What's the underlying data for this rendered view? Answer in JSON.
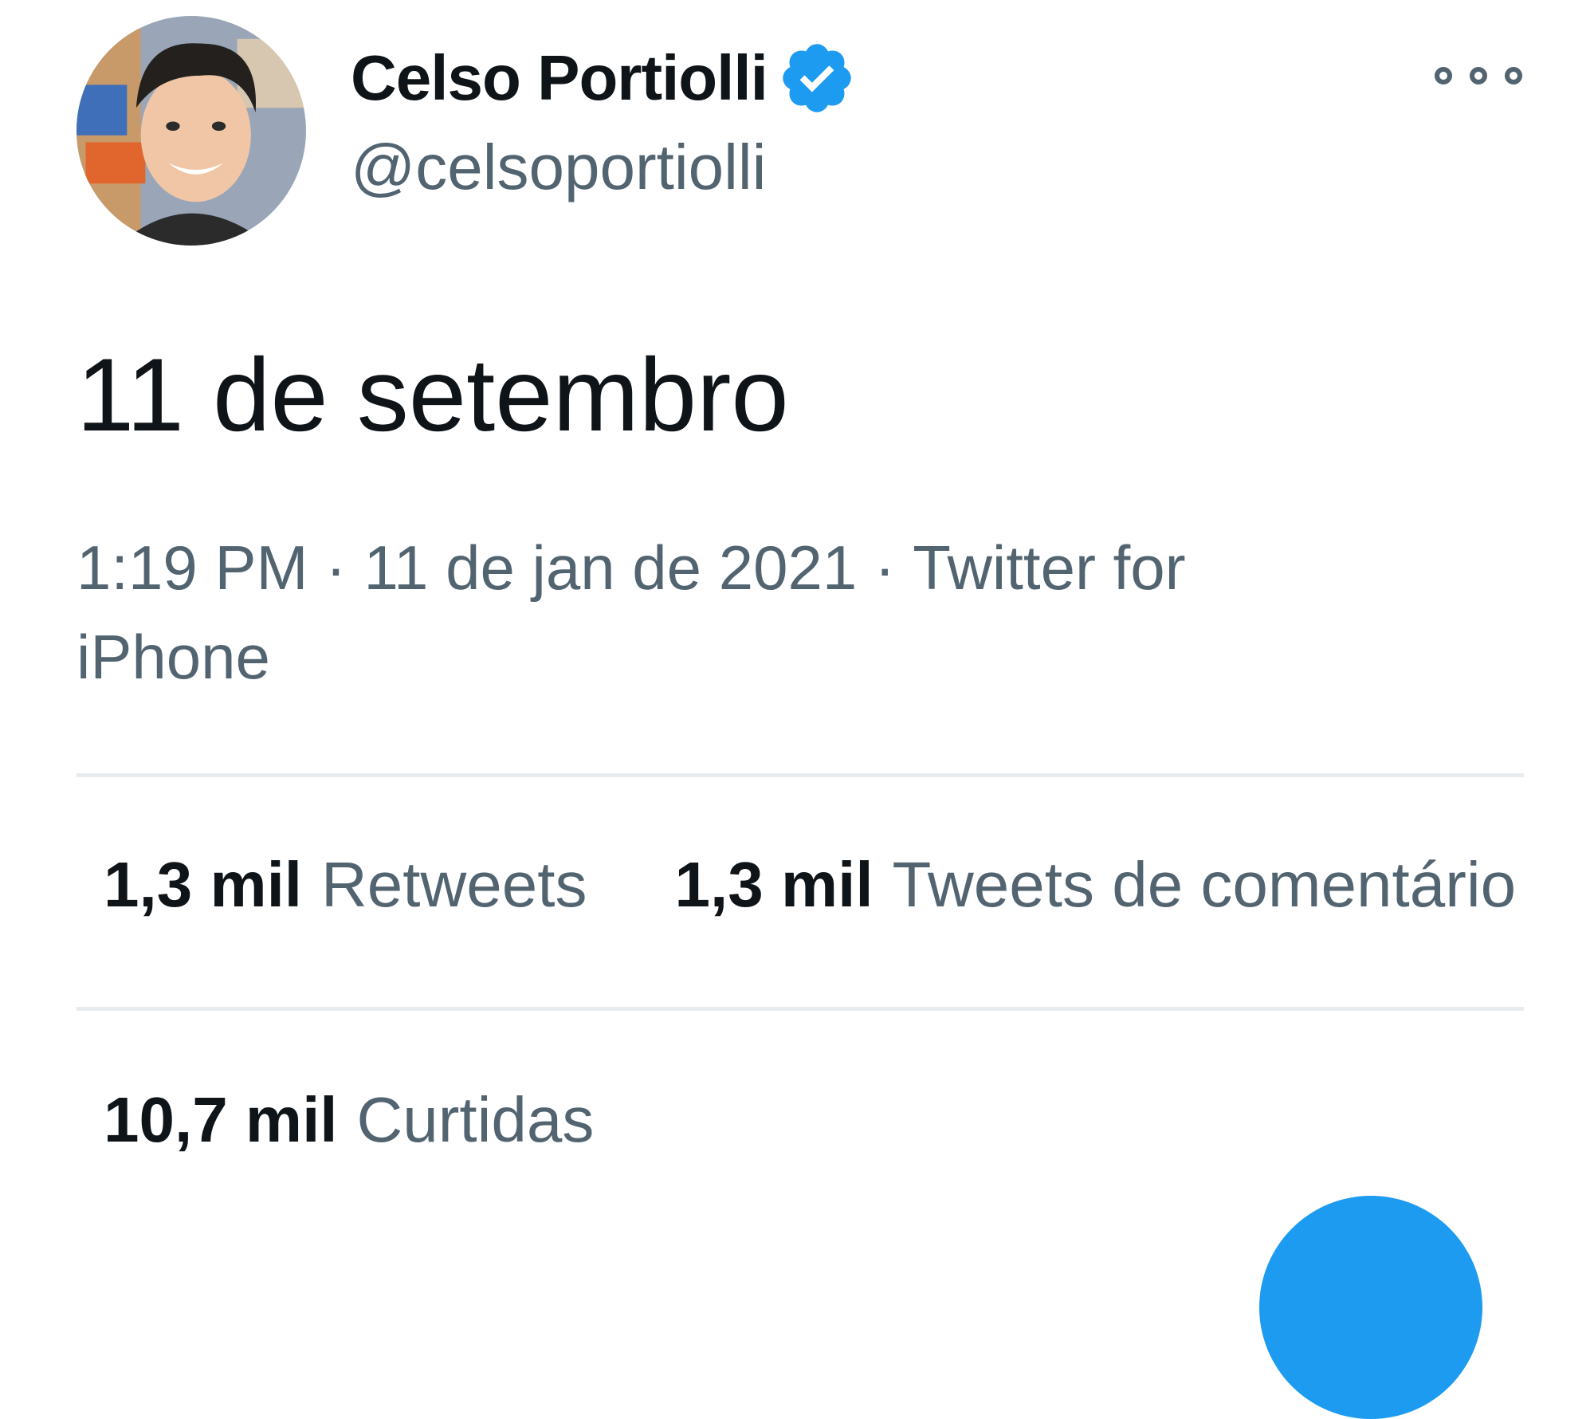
{
  "tweet": {
    "author": {
      "display_name": "Celso Portiolli",
      "handle": "@celsoportiolli",
      "verified": true
    },
    "text": "11 de setembro",
    "time": "1:19 PM",
    "separator": "·",
    "date": "11 de jan de 2021",
    "source": "Twitter for iPhone"
  },
  "stats": {
    "retweets": {
      "count": "1,3 mil",
      "label": "Retweets"
    },
    "quotes": {
      "count": "1,3 mil",
      "label": "Tweets de comentário"
    },
    "likes": {
      "count": "10,7 mil",
      "label": "Curtidas"
    }
  },
  "icons": {
    "verified": "verified-badge-icon",
    "more": "more-options-icon",
    "fab": "compose-tweet-button"
  },
  "colors": {
    "primary_text": "#0f1419",
    "secondary_text": "#536471",
    "accent": "#1d9bf0",
    "divider": "#e9ecef"
  }
}
